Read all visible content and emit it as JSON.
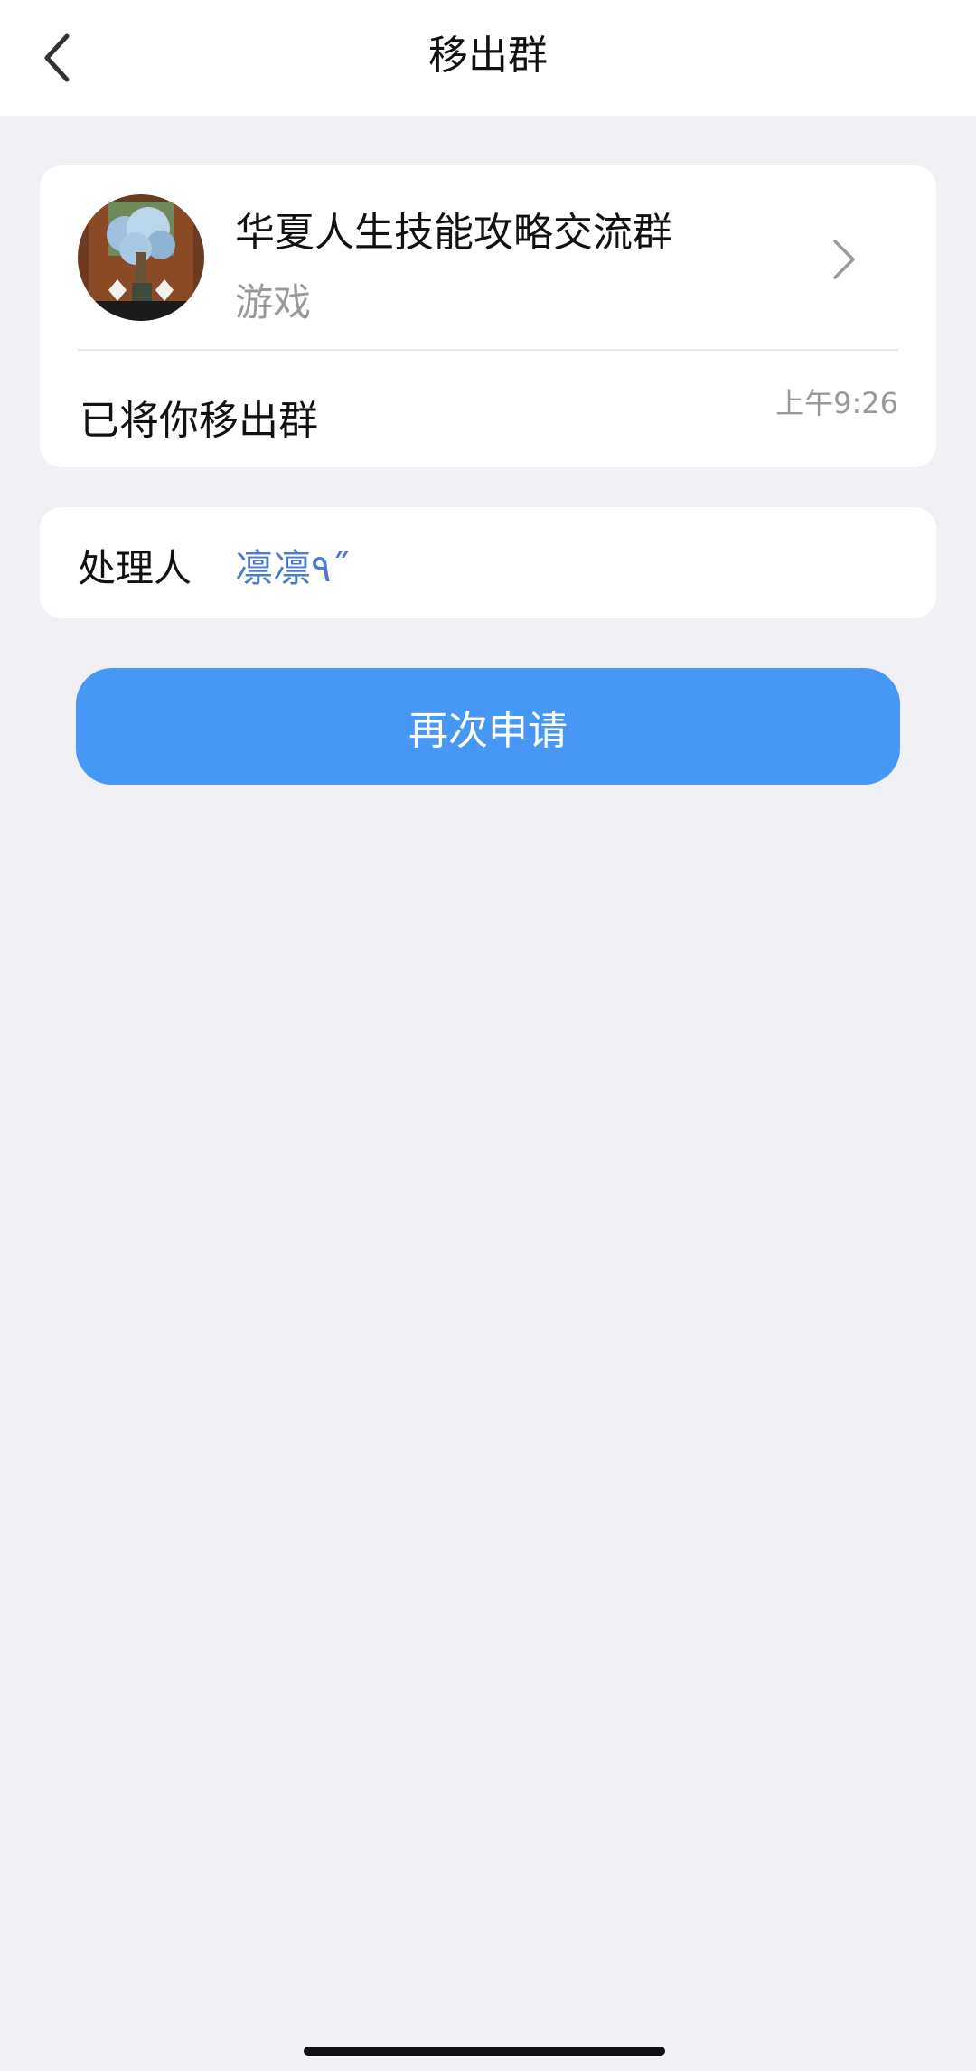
{
  "nav": {
    "title": "移出群",
    "back_icon": "chevron-left-icon"
  },
  "group": {
    "name": "华夏人生技能攻略交流群",
    "category": "游戏",
    "avatar_icon": "group-avatar",
    "chevron_icon": "chevron-right-icon"
  },
  "notice": {
    "message": "已将你移出群",
    "time": "上午9:26"
  },
  "handler": {
    "label": "处理人",
    "name": "凛凛٩˝"
  },
  "actions": {
    "reapply_label": "再次申请"
  },
  "colors": {
    "page_bg": "#f0f0f5",
    "card_bg": "#ffffff",
    "accent_button": "#4798f5",
    "link_blue": "#4a7bd0",
    "secondary_text": "#999999"
  }
}
